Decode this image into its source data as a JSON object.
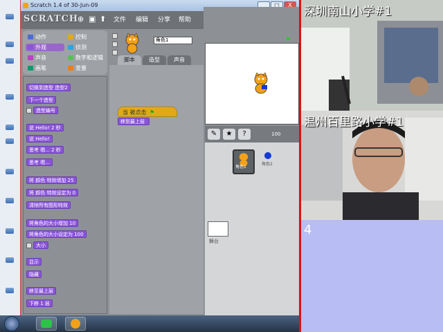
{
  "window": {
    "title": "Scratch 1.4 of 30-Jun-09",
    "logo": "SCRATCH",
    "menus": [
      "文件",
      "编辑",
      "分享",
      "帮助"
    ],
    "controls": [
      "_",
      "□",
      "X"
    ]
  },
  "categories": [
    {
      "label": "动作",
      "color": "#4a6cd4"
    },
    {
      "label": "控制",
      "color": "#e1a91a"
    },
    {
      "label": "外观",
      "color": "#8a55d7",
      "selected": true
    },
    {
      "label": "侦测",
      "color": "#2ca5e2"
    },
    {
      "label": "声音",
      "color": "#bb42c3"
    },
    {
      "label": "数字和逻辑",
      "color": "#59c059"
    },
    {
      "label": "画笔",
      "color": "#0e9a6c"
    },
    {
      "label": "变量",
      "color": "#ee7d16"
    }
  ],
  "palette_blocks": [
    "切换到造型 造型2",
    "下一个造型",
    "造型编号",
    "说 Hello! 2 秒",
    "说 Hello!",
    "思考 嗯... 2 秒",
    "思考 嗯...",
    "将 颜色 特效增加 25",
    "将 颜色 特效设定为 0",
    "清除所有图形特效",
    "将角色的大小增加 10",
    "将角色的大小设定为 100",
    "大小",
    "显示",
    "隐藏",
    "移至最上层",
    "下移 1 层"
  ],
  "sprite": {
    "name": "角色1",
    "tabs": [
      "脚本",
      "造型",
      "声音"
    ]
  },
  "script": {
    "hat": "当 被点击",
    "stack": "移到最上层"
  },
  "stage": {
    "zoom": "100"
  },
  "sprite_list": {
    "sprite_label": "角色1",
    "stage_label": "舞台",
    "blue_label": "角色2"
  },
  "video": {
    "cam1_label": "深圳南山小学#1",
    "cam2_label": "温州百里路小学#1",
    "cam3_label": "4"
  }
}
